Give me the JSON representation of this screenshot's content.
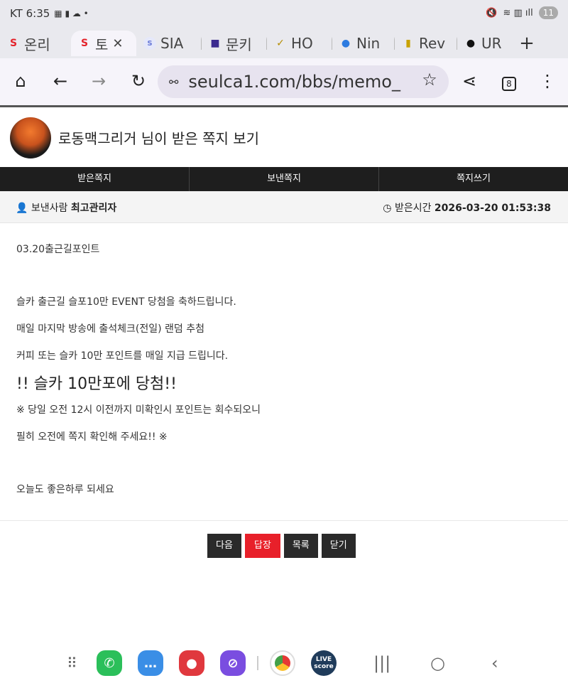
{
  "status": {
    "carrier_time": "KT 6:35",
    "battery": "11"
  },
  "tabs": [
    {
      "favicon": "S",
      "label": "온리",
      "fav_color": "#e4232b"
    },
    {
      "favicon": "S",
      "label": "토",
      "fav_color": "#e4232b",
      "close": "✕",
      "active": true
    },
    {
      "favicon": "S",
      "label": "SIA",
      "fav_color": "#6a7ad8"
    },
    {
      "favicon": "■",
      "label": "문키",
      "fav_color": "#3b2a8f"
    },
    {
      "favicon": "✓",
      "label": "HO",
      "fav_color": "#b58c00"
    },
    {
      "favicon": "●",
      "label": "Nin",
      "fav_color": "#2d7be0"
    },
    {
      "favicon": "▮",
      "label": "Rev",
      "fav_color": "#c9a200"
    },
    {
      "favicon": "●",
      "label": "UR",
      "fav_color": "#111111"
    }
  ],
  "toolbar": {
    "new_tab": "+",
    "url": "seulca1.com/bbs/memo_",
    "tab_count": "8"
  },
  "memo": {
    "title": "로동맥그리거 님이 받은 쪽지 보기",
    "nav": [
      "받은쪽지",
      "보낸쪽지",
      "쪽지쓰기"
    ],
    "sender_label": "보낸사람",
    "sender": "최고관리자",
    "time_label": "받은시간",
    "time": "2026-03-20 01:53:38",
    "lines": {
      "l1": "03.20출근길포인트",
      "l2": "슬카 출근길 슬포10만 EVENT 당첨을 축하드립니다.",
      "l3": "매일 마지막 방송에 출석체크(전일) 랜덤 추첨",
      "l4": "커피 또는 슬카 10만 포인트를 매일 지급 드립니다.",
      "l5": "!! 슬카 10만포에 당첨!!",
      "l6": "※ 당일 오전 12시 이전까지 미확인시 포인트는 회수되오니",
      "l7": "필히 오전에 쪽지 확인해 주세요!! ※",
      "l8": "오늘도 좋은하루 되세요"
    },
    "buttons": {
      "next": "다음",
      "reply": "답장",
      "list": "목록",
      "close": "닫기"
    }
  },
  "navbar": {
    "live_app_label": "LIVE score"
  },
  "colors": {
    "reply_red": "#e8202a",
    "nav_dark": "#1e1e1e"
  }
}
